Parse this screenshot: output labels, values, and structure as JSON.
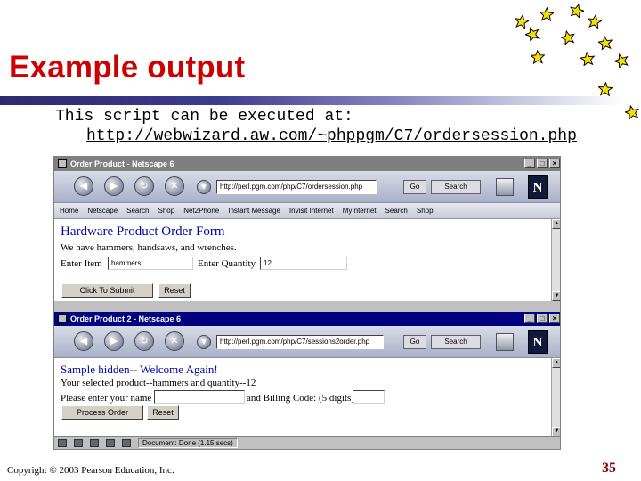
{
  "slide": {
    "title": "Example output",
    "line1": "This script can be executed at:",
    "link": "http://webwizard.aw.com/~phppgm/C7/ordersession.php",
    "copyright": "Copyright © 2003 Pearson Education, Inc.",
    "page_number": "35"
  },
  "colors": {
    "title": "#cc0000",
    "page_number": "#8b0000",
    "star_fill": "#f6e000",
    "star_outline": "#000000"
  },
  "window1": {
    "title": "Order Product - Netscape 6",
    "url": "http://perl.pgm.com/php/C7/ordersession.php",
    "go_label": "Go",
    "search_label": "Search",
    "links": [
      "Home",
      "Netscape",
      "Search",
      "Shop",
      "Net2Phone",
      "Instant Message",
      "Invisit Internet",
      "MyInternet",
      "Search",
      "Shop"
    ],
    "form_heading": "Hardware Product Order Form",
    "form_text": "We have hammers, handsaws, and wrenches.",
    "item_label": "Enter Item",
    "item_value": "hammers",
    "quantity_label": "Enter Quantity",
    "quantity_value": "12",
    "submit_label": "Click To Submit",
    "reset_label": "Reset"
  },
  "window2": {
    "title": "Order Product 2 - Netscape 6",
    "url": "http://perl.pgm.com/php/C7/sessions2order.php",
    "go_label": "Go",
    "search_label": "Search",
    "heading": "Sample hidden-- Welcome Again!",
    "selection_text": "Your selected product--hammers and quantity--12",
    "name_prompt": "Please enter your name",
    "billing_prompt": "and Billing Code: (5 digits)",
    "process_label": "Process Order",
    "reset_label": "Reset",
    "status_text": "Document: Done (1.15 secs)"
  }
}
